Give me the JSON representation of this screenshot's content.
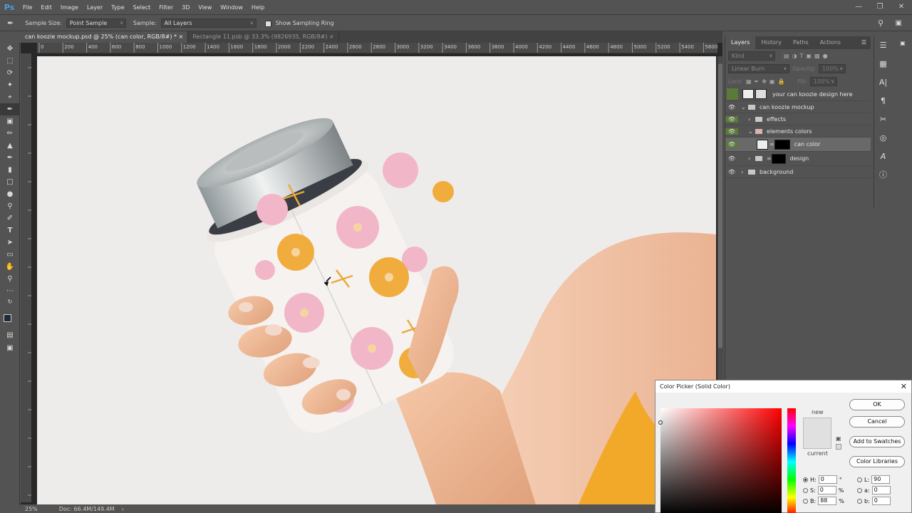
{
  "app": {
    "logo": "Ps"
  },
  "menu": [
    "File",
    "Edit",
    "Image",
    "Layer",
    "Type",
    "Select",
    "Filter",
    "3D",
    "View",
    "Window",
    "Help"
  ],
  "options": {
    "sample_size_label": "Sample Size:",
    "sample_size_value": "Point Sample",
    "sample_label": "Sample:",
    "sample_value": "All Layers",
    "show_ring_label": "Show Sampling Ring"
  },
  "doc_tabs": [
    {
      "label": "can koozie mockup.psd @ 25% (can color, RGB/8#) *",
      "active": true
    },
    {
      "label": "Rectangle 11.psb @ 33.3% (9826935, RGB/8#)",
      "active": false
    }
  ],
  "ruler_ticks": [
    "0",
    "200",
    "400",
    "600",
    "800",
    "1000",
    "1200",
    "1400",
    "1600",
    "1800",
    "2000",
    "2200",
    "2400",
    "2600",
    "2800",
    "3000",
    "3200",
    "3400",
    "3600",
    "3800",
    "4000",
    "4200",
    "4400",
    "4600",
    "4800",
    "5000",
    "5200",
    "5400",
    "5600"
  ],
  "status": {
    "zoom": "25%",
    "doc": "Doc: 66.4M/149.4M"
  },
  "panel": {
    "tabs": [
      "Layers",
      "History",
      "Paths",
      "Actions"
    ],
    "kind_placeholder": "Kind",
    "blend_mode": "Linear Burn",
    "opacity_label": "Opacity:",
    "opacity_value": "100%",
    "lock_label": "Lock:",
    "fill_label": "Fill:",
    "fill_value": "100%",
    "layers": [
      {
        "name": "your can koozie design here",
        "indent": 0
      },
      {
        "name": "can koozie mockup",
        "indent": 0
      },
      {
        "name": "effects",
        "indent": 1
      },
      {
        "name": "elements colors",
        "indent": 1
      },
      {
        "name": "can color",
        "indent": 2
      },
      {
        "name": "design",
        "indent": 1
      },
      {
        "name": "background",
        "indent": 0
      }
    ]
  },
  "color_picker": {
    "title": "Color Picker (Solid Color)",
    "ok": "OK",
    "cancel": "Cancel",
    "add_swatches": "Add to Swatches",
    "libraries": "Color Libraries",
    "new_label": "new",
    "current_label": "current",
    "swatch_color": "#e0e0e0",
    "h_label": "H:",
    "h_value": "0",
    "h_unit": "°",
    "s_label": "S:",
    "s_value": "0",
    "s_unit": "%",
    "b_label": "B:",
    "b_value": "88",
    "b_unit": "%",
    "l_label": "L:",
    "l_value": "90",
    "a_label": "a:",
    "a_value": "0",
    "bb_label": "b:",
    "bb_value": "0"
  }
}
